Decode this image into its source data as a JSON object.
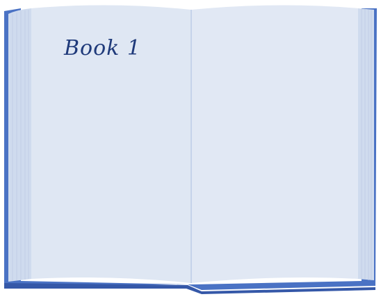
{
  "book": {
    "title": "Book 1",
    "colors": {
      "cover": "#4a72c4",
      "cover_dark": "#3558a8",
      "page": "#dfe7f3",
      "page_edge": "#cfdbee",
      "ink": "#1f3a7a"
    }
  }
}
